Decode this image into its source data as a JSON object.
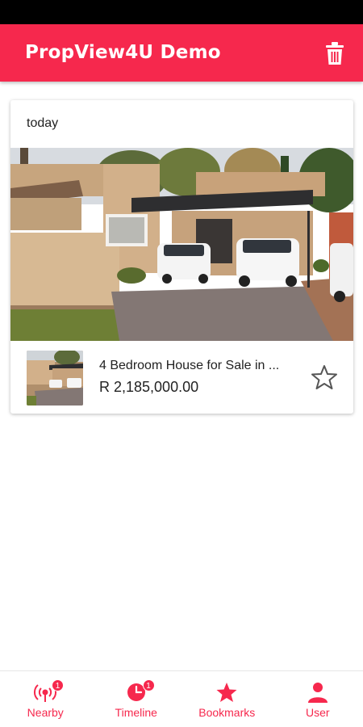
{
  "app": {
    "title": "PropView4U Demo"
  },
  "colors": {
    "accent": "#f6284d",
    "status_bar": "#000000"
  },
  "card": {
    "date": "today",
    "listing": {
      "title": "4 Bedroom House for Sale in ...",
      "price": "R 2,185,000.00"
    }
  },
  "icons": {
    "header": "trash-icon",
    "favorite": "star-outline-icon"
  },
  "bottom_nav": {
    "items": [
      {
        "label": "Nearby",
        "icon": "broadcast-icon",
        "badge": "1"
      },
      {
        "label": "Timeline",
        "icon": "clock-icon",
        "badge": "1"
      },
      {
        "label": "Bookmarks",
        "icon": "star-icon"
      },
      {
        "label": "User",
        "icon": "user-icon"
      }
    ]
  }
}
